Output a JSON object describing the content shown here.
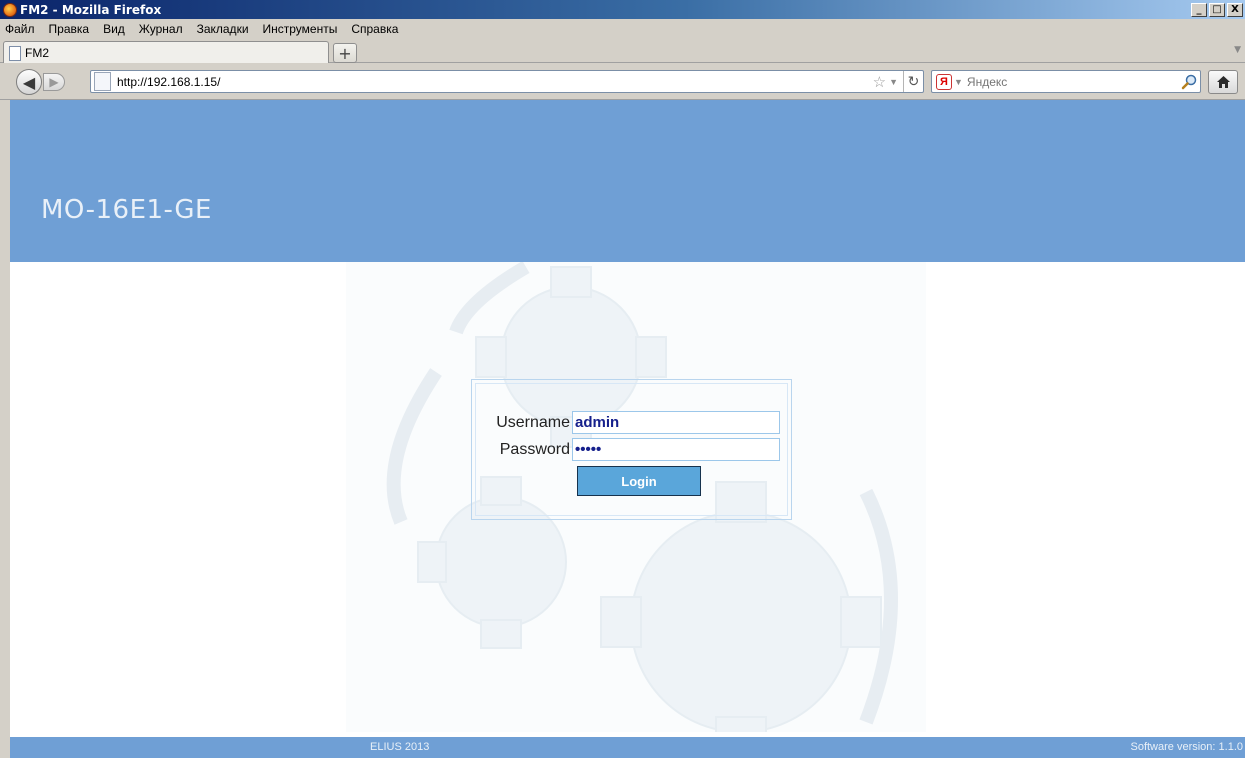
{
  "window": {
    "title": "FM2 - Mozilla Firefox",
    "controls": {
      "minimize": "_",
      "maximize": "□",
      "close": "X"
    }
  },
  "menu": [
    "Файл",
    "Правка",
    "Вид",
    "Журнал",
    "Закладки",
    "Инструменты",
    "Справка"
  ],
  "tab": {
    "title": "FM2",
    "new_tab_label": "+"
  },
  "nav": {
    "url": "http://192.168.1.15/",
    "search_placeholder": "Яндекс"
  },
  "page": {
    "device_name": "MO-16E1-GE",
    "login": {
      "username_label": "Username",
      "username_value": "admin",
      "password_label": "Password",
      "password_value": "admin",
      "button_label": "Login"
    },
    "footer": {
      "copyright": "ELIUS 2013",
      "version": "Software version: 1.1.0"
    }
  },
  "colors": {
    "header_bg": "#6f9fd5",
    "button_bg": "#5aa6da"
  },
  "icons": [
    "firefox-icon",
    "page-icon",
    "back-arrow-icon",
    "forward-arrow-icon",
    "star-icon",
    "reload-icon",
    "yandex-icon",
    "magnifier-icon",
    "home-icon"
  ]
}
